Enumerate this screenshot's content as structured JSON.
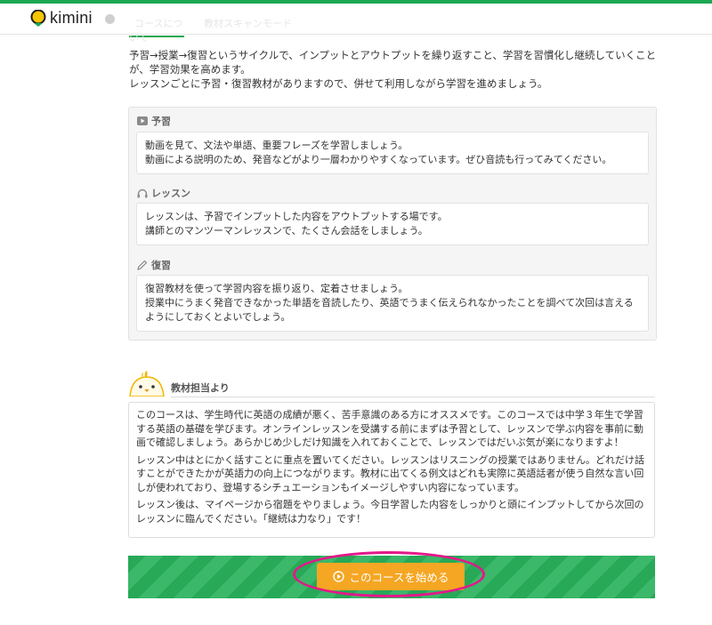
{
  "app": {
    "logo_text": "kimini"
  },
  "tabs": [
    {
      "label": "コースについて"
    },
    {
      "label": "教材スキャンモード"
    }
  ],
  "intro": {
    "line1": "予習→授業→復習というサイクルで、インプットとアウトプットを繰り返すこと、学習を習慣化し継続していくことが、学習効果を高めます。",
    "line2": "レッスンごとに予習・復習教材がありますので、併せて利用しながら学習を進めましょう。"
  },
  "phases": [
    {
      "icon": "video-icon",
      "title": "予習",
      "lines": [
        "動画を見て、文法や単語、重要フレーズを学習しましょう。",
        "動画による説明のため、発音などがより一層わかりやすくなっています。ぜひ音読も行ってみてください。"
      ]
    },
    {
      "icon": "headphones-icon",
      "title": "レッスン",
      "lines": [
        "レッスンは、予習でインプットした内容をアウトプットする場です。",
        "講師とのマンツーマンレッスンで、たくさん会話をしましょう。"
      ]
    },
    {
      "icon": "pencil-icon",
      "title": "復習",
      "lines": [
        "復習教材を使って学習内容を振り返り、定着させましょう。",
        "授業中にうまく発音できなかった単語を音読したり、英語でうまく伝えられなかったことを調べて次回は言えるようにしておくとよいでしょう。"
      ]
    }
  ],
  "teacher": {
    "title": "教材担当より",
    "paragraphs": [
      "このコースは、学生時代に英語の成績が悪く、苦手意識のある方にオススメです。このコースでは中学３年生で学習する英語の基礎を学びます。オンラインレッスンを受講する前にまずは予習として、レッスンで学ぶ内容を事前に動画で確認しましょう。あらかじめ少しだけ知識を入れておくことで、レッスンではだいぶ気が楽になりますよ！",
      "レッスン中はとにかく話すことに重点を置いてください。レッスンはリスニングの授業ではありません。どれだけ話すことができたかが英語力の向上につながります。教材に出てくる例文はどれも実際に英語話者が使う自然な言い回しが使われており、登場するシチュエーションもイメージしやすい内容になっています。",
      "レッスン後は、マイページから宿題をやりましょう。今日学習した内容をしっかりと頭にインプットしてから次回のレッスンに臨んでください。「継続は力なり」です！"
    ]
  },
  "cta": {
    "label": "このコースを始める",
    "icon": "play-circle-icon"
  },
  "colors": {
    "brand_green": "#1aa652",
    "cta_orange": "#f5a623",
    "highlight_pink": "#e4178a"
  }
}
